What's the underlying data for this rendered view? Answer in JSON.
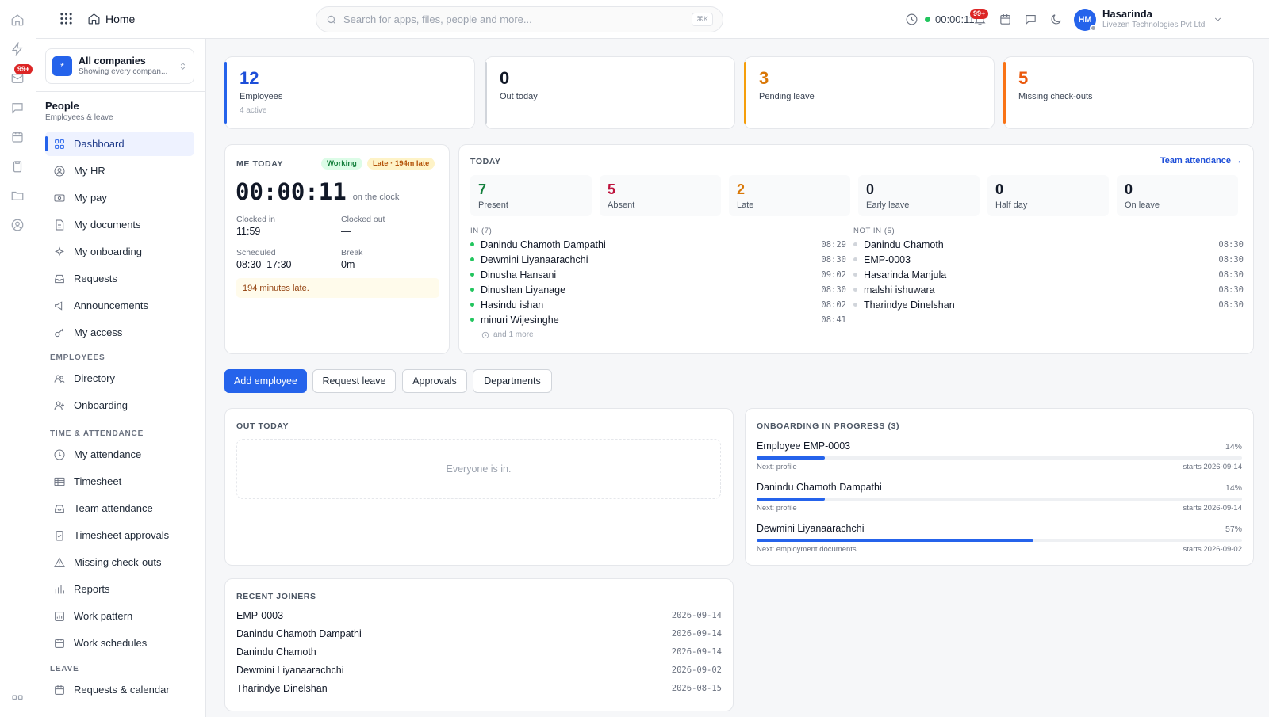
{
  "rail": {
    "mail_badge": "99+"
  },
  "topbar": {
    "home_label": "Home",
    "search_placeholder": "Search for apps, files, people and more...",
    "search_shortcut": "⌘K",
    "timer": "00:00:11",
    "notif_badge": "99+",
    "user_name": "Hasarinda",
    "user_company": "Livezen Technologies Pvt Ltd",
    "avatar_initials": "HM"
  },
  "sidebar": {
    "company_name": "All companies",
    "company_sub": "Showing every compan...",
    "section_title": "People",
    "section_sub": "Employees & leave",
    "main_items": [
      "Dashboard",
      "My HR",
      "My pay",
      "My documents",
      "My onboarding",
      "Requests",
      "Announcements",
      "My access"
    ],
    "employees_title": "EMPLOYEES",
    "employees_items": [
      "Directory",
      "Onboarding"
    ],
    "time_title": "TIME & ATTENDANCE",
    "time_items": [
      "My attendance",
      "Timesheet",
      "Team attendance",
      "Timesheet approvals",
      "Missing check-outs",
      "Reports",
      "Work pattern",
      "Work schedules"
    ],
    "leave_title": "LEAVE",
    "leave_items": [
      "Requests & calendar"
    ]
  },
  "stats": [
    {
      "value": "12",
      "label": "Employees",
      "sub": "4 active"
    },
    {
      "value": "0",
      "label": "Out today",
      "sub": ""
    },
    {
      "value": "3",
      "label": "Pending leave",
      "sub": ""
    },
    {
      "value": "5",
      "label": "Missing check-outs",
      "sub": ""
    }
  ],
  "me_today": {
    "title": "ME TODAY",
    "status": "Working",
    "late_tag": "Late · 194m late",
    "clock": "00:00:11",
    "clock_suffix": "on the clock",
    "clocked_in_label": "Clocked in",
    "clocked_in": "11:59",
    "clocked_out_label": "Clocked out",
    "clocked_out": "—",
    "scheduled_label": "Scheduled",
    "scheduled": "08:30–17:30",
    "break_label": "Break",
    "break": "0m",
    "late_note": "194 minutes late."
  },
  "today": {
    "title": "TODAY",
    "link": "Team attendance →",
    "metrics": [
      {
        "value": "7",
        "label": "Present",
        "color": "#15803d"
      },
      {
        "value": "5",
        "label": "Absent",
        "color": "#be123c"
      },
      {
        "value": "2",
        "label": "Late",
        "color": "#d97706"
      },
      {
        "value": "0",
        "label": "Early leave",
        "color": "#111827"
      },
      {
        "value": "0",
        "label": "Half day",
        "color": "#111827"
      },
      {
        "value": "0",
        "label": "On leave",
        "color": "#111827"
      }
    ],
    "in_title": "IN (7)",
    "in_list": [
      {
        "name": "Danindu Chamoth Dampathi",
        "time": "08:29"
      },
      {
        "name": "Dewmini Liyanaarachchi",
        "time": "08:30"
      },
      {
        "name": "Dinusha Hansani",
        "time": "09:02"
      },
      {
        "name": "Dinushan Liyanage",
        "time": "08:30"
      },
      {
        "name": "Hasindu ishan",
        "time": "08:02"
      },
      {
        "name": "minuri Wijesinghe",
        "time": "08:41"
      }
    ],
    "in_more": "and 1 more",
    "notin_title": "NOT IN (5)",
    "notin_list": [
      {
        "name": "Danindu Chamoth",
        "time": "08:30"
      },
      {
        "name": "EMP-0003",
        "time": "08:30"
      },
      {
        "name": "Hasarinda Manjula",
        "time": "08:30"
      },
      {
        "name": "malshi ishuwara",
        "time": "08:30"
      },
      {
        "name": "Tharindye Dinelshan",
        "time": "08:30"
      }
    ]
  },
  "actions": [
    "Add employee",
    "Request leave",
    "Approvals",
    "Departments"
  ],
  "out_today": {
    "title": "OUT TODAY",
    "empty": "Everyone is in."
  },
  "onboarding": {
    "title": "ONBOARDING IN PROGRESS (3)",
    "items": [
      {
        "name": "Employee EMP-0003",
        "pct": "14%",
        "progress": 14,
        "next": "Next: profile",
        "starts": "starts 2026-09-14"
      },
      {
        "name": "Danindu Chamoth Dampathi",
        "pct": "14%",
        "progress": 14,
        "next": "Next: profile",
        "starts": "starts 2026-09-14"
      },
      {
        "name": "Dewmini Liyanaarachchi",
        "pct": "57%",
        "progress": 57,
        "next": "Next: employment documents",
        "starts": "starts 2026-09-02"
      }
    ]
  },
  "recent": {
    "title": "RECENT JOINERS",
    "items": [
      {
        "name": "EMP-0003",
        "date": "2026-09-14"
      },
      {
        "name": "Danindu Chamoth Dampathi",
        "date": "2026-09-14"
      },
      {
        "name": "Danindu Chamoth",
        "date": "2026-09-14"
      },
      {
        "name": "Dewmini Liyanaarachchi",
        "date": "2026-09-02"
      },
      {
        "name": "Tharindye Dinelshan",
        "date": "2026-08-15"
      }
    ]
  }
}
